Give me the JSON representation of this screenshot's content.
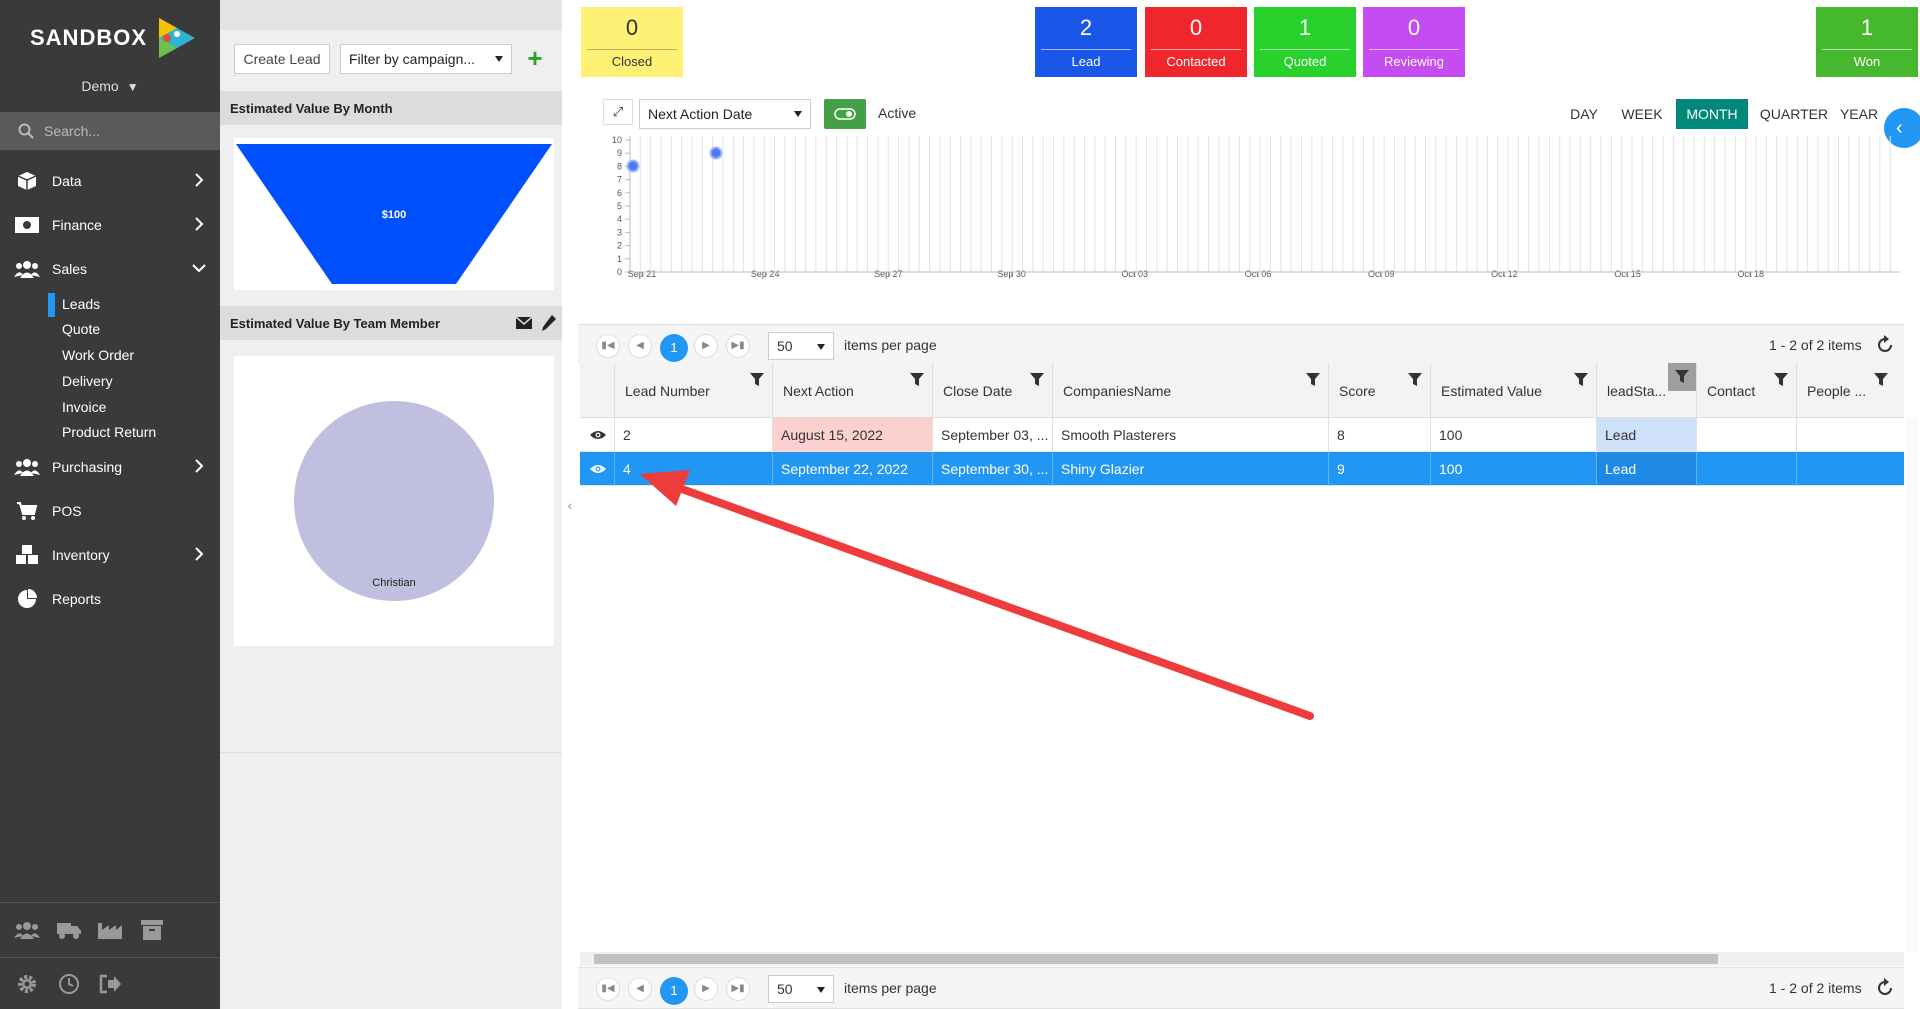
{
  "sidebar": {
    "logo": "SANDBOX",
    "env": "Demo",
    "search_placeholder": "Search...",
    "items": [
      {
        "label": "Data",
        "icon": "cube-icon"
      },
      {
        "label": "Finance",
        "icon": "money-icon"
      },
      {
        "label": "Sales",
        "icon": "users-icon"
      },
      {
        "label": "Purchasing",
        "icon": "users-icon"
      },
      {
        "label": "POS",
        "icon": "cart-icon"
      },
      {
        "label": "Inventory",
        "icon": "cubes-icon"
      },
      {
        "label": "Reports",
        "icon": "pie-chart-icon"
      }
    ],
    "sales_sub": [
      "Leads",
      "Quote",
      "Work Order",
      "Delivery",
      "Invoice",
      "Product Return"
    ],
    "active_sub": "Leads"
  },
  "mid": {
    "create_lead": "Create Lead",
    "campaign_filter": "Filter by campaign...",
    "month_title": "Estimated Value By Month",
    "team_title": "Estimated Value By Team Member"
  },
  "stats": [
    {
      "count": "0",
      "label": "Closed",
      "color": "#fff176"
    },
    {
      "count": "2",
      "label": "Lead",
      "color": "#1a56e8"
    },
    {
      "count": "0",
      "label": "Contacted",
      "color": "#f0262d"
    },
    {
      "count": "1",
      "label": "Quoted",
      "color": "#29d12d"
    },
    {
      "count": "0",
      "label": "Reviewing",
      "color": "#c54cf0"
    },
    {
      "count": "1",
      "label": "Won",
      "color": "#46b82e"
    }
  ],
  "toolbar": {
    "date_field": "Next Action Date",
    "active_label": "Active",
    "ranges": [
      "DAY",
      "WEEK",
      "MONTH",
      "QUARTER",
      "YEAR"
    ],
    "active_range": "MONTH"
  },
  "timeline": {
    "y_ticks": [
      "0",
      "1",
      "2",
      "3",
      "4",
      "5",
      "6",
      "7",
      "8",
      "9",
      "10"
    ],
    "x_ticks": [
      "Sep 21",
      "Sep 24",
      "Sep 27",
      "Sep 30",
      "Oct 03",
      "Oct 06",
      "Oct 09",
      "Oct 12",
      "Oct 15",
      "Oct 18"
    ]
  },
  "pager": {
    "page": "1",
    "page_size": "50",
    "per_page_label": "items per page",
    "info": "1 - 2 of 2 items"
  },
  "grid": {
    "columns": [
      "Lead Number",
      "Next Action",
      "Close Date",
      "CompaniesName",
      "Score",
      "Estimated Value",
      "leadSta...",
      "Contact",
      "People ..."
    ],
    "rows": [
      {
        "lead": "2",
        "next": "August 15, 2022",
        "close": "September 03, ...",
        "company": "Smooth Plasterers",
        "score": "8",
        "value": "100",
        "status": "Lead",
        "contact": "",
        "people": ""
      },
      {
        "lead": "4",
        "next": "September 22, 2022",
        "close": "September 30, ...",
        "company": "Shiny Glazier",
        "score": "9",
        "value": "100",
        "status": "Lead",
        "contact": "",
        "people": ""
      }
    ]
  },
  "chart_data": [
    {
      "type": "funnel",
      "title": "Estimated Value By Month",
      "categories": [
        ""
      ],
      "values": [
        100
      ],
      "labels": [
        "$100"
      ],
      "color": "#0050ff"
    },
    {
      "type": "pie",
      "title": "Estimated Value By Team Member",
      "categories": [
        "Christian"
      ],
      "values": [
        100
      ],
      "color": "#c0bfdf"
    }
  ]
}
